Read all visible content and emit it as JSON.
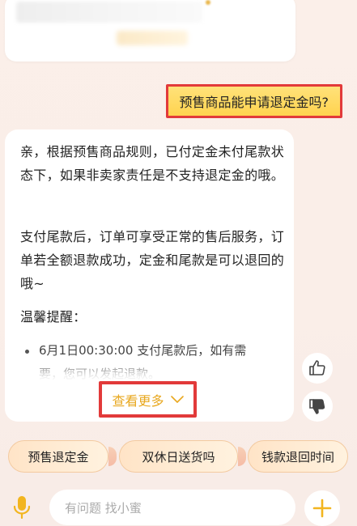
{
  "previous_card": {
    "blurred": true
  },
  "user_message": {
    "text": "预售商品能申请退定金吗?"
  },
  "bot_reply": {
    "paragraphs": [
      "亲，根据预售商品规则，已付定金未付尾款状态下，如果非卖家责任是不支持退定金的哦。",
      "支付尾款后，订单可享受正常的售后服务，订单若全额退款成功，定金和尾款是可以退回的哦~",
      "温馨提醒："
    ],
    "bullet": "6月1日00:30:00 支付尾款后，如有需要，您可以发起退款。",
    "see_more_label": "查看更多"
  },
  "feedback": {
    "like_icon": "thumbs-up-icon",
    "dislike_icon": "thumbs-down-icon"
  },
  "quick_chips": [
    {
      "label": "预售退定金"
    },
    {
      "label": "双休日送货吗"
    },
    {
      "label": "钱款退回时间"
    }
  ],
  "input_bar": {
    "placeholder": "有问题 找小蜜",
    "mic_icon": "microphone-icon",
    "plus_icon": "plus-icon"
  },
  "colors": {
    "accent_yellow": "#ffd34f",
    "highlight_red": "#e23a3a",
    "see_more_gold": "#e8a820",
    "background": "#fbefe9"
  }
}
